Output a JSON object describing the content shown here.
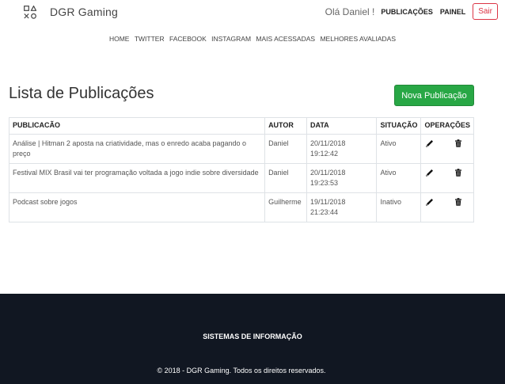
{
  "navbar": {
    "brand": "DGR Gaming",
    "brand_icon": "playstation-symbols-icon",
    "greeting": "Olá Daniel !",
    "links": [
      "PUBLICAÇÕES",
      "PAINEL"
    ],
    "logout_label": "Sair",
    "logout_color": "#dc3545"
  },
  "subnav": [
    "HOME",
    "TWITTER",
    "FACEBOOK",
    "INSTAGRAM",
    "MAIS ACESSADAS",
    "MELHORES AVALIADAS"
  ],
  "main": {
    "title": "Lista de Publicações",
    "new_button_label": "Nova Publicação",
    "new_button_color": "#28a745"
  },
  "table": {
    "headers": [
      "PUBLICACÃO",
      "AUTOR",
      "DATA",
      "SITUAÇÃO",
      "OPERAÇÕES"
    ],
    "rows": [
      {
        "title": "Análise | Hitman 2 aposta na criatividade, mas o enredo acaba pagando o preço",
        "author": "Daniel",
        "date": "20/11/2018 19:12:42",
        "status": "Ativo"
      },
      {
        "title": "Festival MIX Brasil vai ter programação voltada a jogo indie sobre diversidade",
        "author": "Daniel",
        "date": "20/11/2018 19:23:53",
        "status": "Ativo"
      },
      {
        "title": "Podcast sobre jogos",
        "author": "Guilherme",
        "date": "19/11/2018 21:23:44",
        "status": "Inativo"
      }
    ],
    "edit_icon": "pencil-icon",
    "delete_icon": "trash-icon"
  },
  "footer": {
    "title": "SISTEMAS DE INFORMAÇÃO",
    "copyright": "© 2018 - DGR Gaming. Todos os direitos reservados.",
    "background": "#111722"
  }
}
